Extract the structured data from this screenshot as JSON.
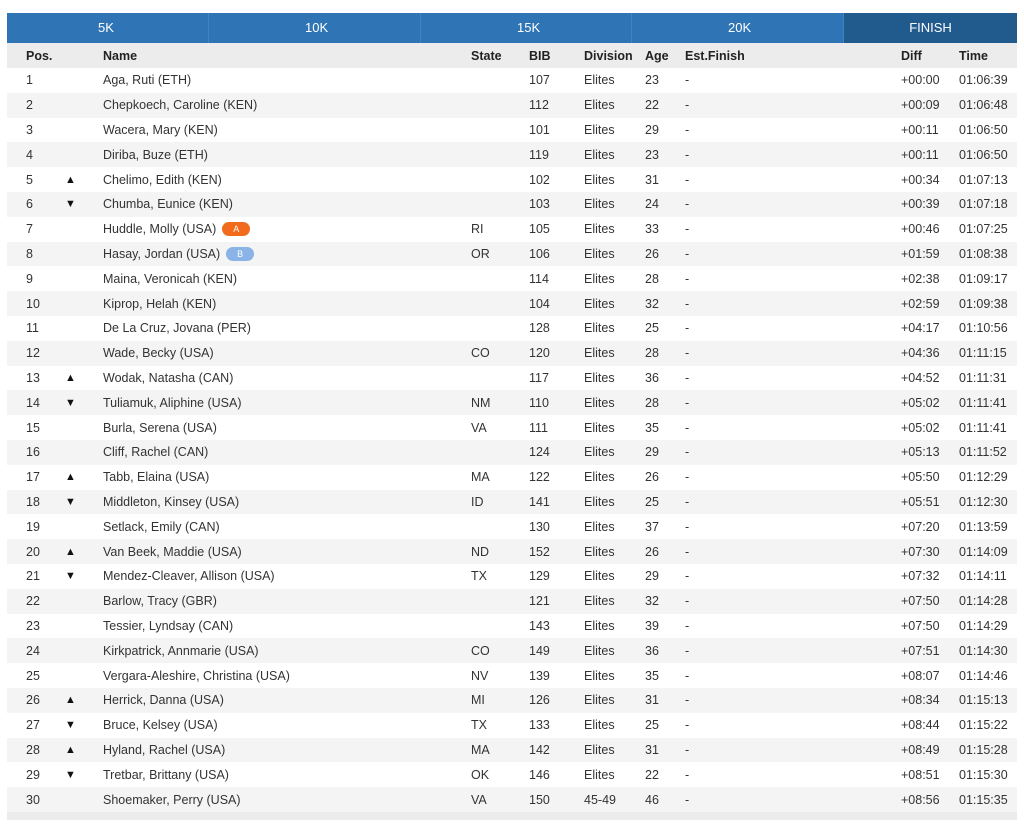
{
  "tabs": [
    {
      "label": "5K"
    },
    {
      "label": "10K"
    },
    {
      "label": "15K"
    },
    {
      "label": "20K"
    },
    {
      "label": "FINISH"
    }
  ],
  "columns": {
    "pos": "Pos.",
    "name": "Name",
    "state": "State",
    "bib": "BIB",
    "division": "Division",
    "age": "Age",
    "est": "Est.Finish",
    "diff": "Diff",
    "time": "Time"
  },
  "arrows": {
    "up": "▲",
    "down": "▼"
  },
  "colors": {
    "header_bar": "#2f74b5",
    "active_tab": "#215b8e",
    "badge_A": "#f26b1d",
    "badge_B": "#8ab4e8"
  },
  "rows": [
    {
      "pos": "1",
      "arrow": "",
      "name": "Aga, Ruti (ETH)",
      "badge": "",
      "state": "",
      "bib": "107",
      "division": "Elites",
      "age": "23",
      "est": "-",
      "diff": "+00:00",
      "time": "01:06:39"
    },
    {
      "pos": "2",
      "arrow": "",
      "name": "Chepkoech, Caroline (KEN)",
      "badge": "",
      "state": "",
      "bib": "112",
      "division": "Elites",
      "age": "22",
      "est": "-",
      "diff": "+00:09",
      "time": "01:06:48"
    },
    {
      "pos": "3",
      "arrow": "",
      "name": "Wacera, Mary (KEN)",
      "badge": "",
      "state": "",
      "bib": "101",
      "division": "Elites",
      "age": "29",
      "est": "-",
      "diff": "+00:11",
      "time": "01:06:50"
    },
    {
      "pos": "4",
      "arrow": "",
      "name": "Diriba, Buze (ETH)",
      "badge": "",
      "state": "",
      "bib": "119",
      "division": "Elites",
      "age": "23",
      "est": "-",
      "diff": "+00:11",
      "time": "01:06:50"
    },
    {
      "pos": "5",
      "arrow": "up",
      "name": "Chelimo, Edith (KEN)",
      "badge": "",
      "state": "",
      "bib": "102",
      "division": "Elites",
      "age": "31",
      "est": "-",
      "diff": "+00:34",
      "time": "01:07:13"
    },
    {
      "pos": "6",
      "arrow": "down",
      "name": "Chumba, Eunice (KEN)",
      "badge": "",
      "state": "",
      "bib": "103",
      "division": "Elites",
      "age": "24",
      "est": "-",
      "diff": "+00:39",
      "time": "01:07:18"
    },
    {
      "pos": "7",
      "arrow": "",
      "name": "Huddle, Molly (USA)",
      "badge": "A",
      "state": "RI",
      "bib": "105",
      "division": "Elites",
      "age": "33",
      "est": "-",
      "diff": "+00:46",
      "time": "01:07:25"
    },
    {
      "pos": "8",
      "arrow": "",
      "name": "Hasay, Jordan (USA)",
      "badge": "B",
      "state": "OR",
      "bib": "106",
      "division": "Elites",
      "age": "26",
      "est": "-",
      "diff": "+01:59",
      "time": "01:08:38"
    },
    {
      "pos": "9",
      "arrow": "",
      "name": "Maina, Veronicah (KEN)",
      "badge": "",
      "state": "",
      "bib": "114",
      "division": "Elites",
      "age": "28",
      "est": "-",
      "diff": "+02:38",
      "time": "01:09:17"
    },
    {
      "pos": "10",
      "arrow": "",
      "name": "Kiprop, Helah (KEN)",
      "badge": "",
      "state": "",
      "bib": "104",
      "division": "Elites",
      "age": "32",
      "est": "-",
      "diff": "+02:59",
      "time": "01:09:38"
    },
    {
      "pos": "11",
      "arrow": "",
      "name": "De La Cruz, Jovana (PER)",
      "badge": "",
      "state": "",
      "bib": "128",
      "division": "Elites",
      "age": "25",
      "est": "-",
      "diff": "+04:17",
      "time": "01:10:56"
    },
    {
      "pos": "12",
      "arrow": "",
      "name": "Wade, Becky (USA)",
      "badge": "",
      "state": "CO",
      "bib": "120",
      "division": "Elites",
      "age": "28",
      "est": "-",
      "diff": "+04:36",
      "time": "01:11:15"
    },
    {
      "pos": "13",
      "arrow": "up",
      "name": "Wodak, Natasha (CAN)",
      "badge": "",
      "state": "",
      "bib": "117",
      "division": "Elites",
      "age": "36",
      "est": "-",
      "diff": "+04:52",
      "time": "01:11:31"
    },
    {
      "pos": "14",
      "arrow": "down",
      "name": "Tuliamuk, Aliphine (USA)",
      "badge": "",
      "state": "NM",
      "bib": "110",
      "division": "Elites",
      "age": "28",
      "est": "-",
      "diff": "+05:02",
      "time": "01:11:41"
    },
    {
      "pos": "15",
      "arrow": "",
      "name": "Burla, Serena (USA)",
      "badge": "",
      "state": "VA",
      "bib": "111",
      "division": "Elites",
      "age": "35",
      "est": "-",
      "diff": "+05:02",
      "time": "01:11:41"
    },
    {
      "pos": "16",
      "arrow": "",
      "name": "Cliff, Rachel (CAN)",
      "badge": "",
      "state": "",
      "bib": "124",
      "division": "Elites",
      "age": "29",
      "est": "-",
      "diff": "+05:13",
      "time": "01:11:52"
    },
    {
      "pos": "17",
      "arrow": "up",
      "name": "Tabb, Elaina (USA)",
      "badge": "",
      "state": "MA",
      "bib": "122",
      "division": "Elites",
      "age": "26",
      "est": "-",
      "diff": "+05:50",
      "time": "01:12:29"
    },
    {
      "pos": "18",
      "arrow": "down",
      "name": "Middleton, Kinsey (USA)",
      "badge": "",
      "state": "ID",
      "bib": "141",
      "division": "Elites",
      "age": "25",
      "est": "-",
      "diff": "+05:51",
      "time": "01:12:30"
    },
    {
      "pos": "19",
      "arrow": "",
      "name": "Setlack, Emily (CAN)",
      "badge": "",
      "state": "",
      "bib": "130",
      "division": "Elites",
      "age": "37",
      "est": "-",
      "diff": "+07:20",
      "time": "01:13:59"
    },
    {
      "pos": "20",
      "arrow": "up",
      "name": "Van Beek, Maddie (USA)",
      "badge": "",
      "state": "ND",
      "bib": "152",
      "division": "Elites",
      "age": "26",
      "est": "-",
      "diff": "+07:30",
      "time": "01:14:09"
    },
    {
      "pos": "21",
      "arrow": "down",
      "name": "Mendez-Cleaver, Allison (USA)",
      "badge": "",
      "state": "TX",
      "bib": "129",
      "division": "Elites",
      "age": "29",
      "est": "-",
      "diff": "+07:32",
      "time": "01:14:11"
    },
    {
      "pos": "22",
      "arrow": "",
      "name": "Barlow, Tracy (GBR)",
      "badge": "",
      "state": "",
      "bib": "121",
      "division": "Elites",
      "age": "32",
      "est": "-",
      "diff": "+07:50",
      "time": "01:14:28"
    },
    {
      "pos": "23",
      "arrow": "",
      "name": "Tessier, Lyndsay (CAN)",
      "badge": "",
      "state": "",
      "bib": "143",
      "division": "Elites",
      "age": "39",
      "est": "-",
      "diff": "+07:50",
      "time": "01:14:29"
    },
    {
      "pos": "24",
      "arrow": "",
      "name": "Kirkpatrick, Annmarie (USA)",
      "badge": "",
      "state": "CO",
      "bib": "149",
      "division": "Elites",
      "age": "36",
      "est": "-",
      "diff": "+07:51",
      "time": "01:14:30"
    },
    {
      "pos": "25",
      "arrow": "",
      "name": "Vergara-Aleshire, Christina (USA)",
      "badge": "",
      "state": "NV",
      "bib": "139",
      "division": "Elites",
      "age": "35",
      "est": "-",
      "diff": "+08:07",
      "time": "01:14:46"
    },
    {
      "pos": "26",
      "arrow": "up",
      "name": "Herrick, Danna (USA)",
      "badge": "",
      "state": "MI",
      "bib": "126",
      "division": "Elites",
      "age": "31",
      "est": "-",
      "diff": "+08:34",
      "time": "01:15:13"
    },
    {
      "pos": "27",
      "arrow": "down",
      "name": "Bruce, Kelsey (USA)",
      "badge": "",
      "state": "TX",
      "bib": "133",
      "division": "Elites",
      "age": "25",
      "est": "-",
      "diff": "+08:44",
      "time": "01:15:22"
    },
    {
      "pos": "28",
      "arrow": "up",
      "name": "Hyland, Rachel (USA)",
      "badge": "",
      "state": "MA",
      "bib": "142",
      "division": "Elites",
      "age": "31",
      "est": "-",
      "diff": "+08:49",
      "time": "01:15:28"
    },
    {
      "pos": "29",
      "arrow": "down",
      "name": "Tretbar, Brittany (USA)",
      "badge": "",
      "state": "OK",
      "bib": "146",
      "division": "Elites",
      "age": "22",
      "est": "-",
      "diff": "+08:51",
      "time": "01:15:30"
    },
    {
      "pos": "30",
      "arrow": "",
      "name": "Shoemaker, Perry (USA)",
      "badge": "",
      "state": "VA",
      "bib": "150",
      "division": "45-49",
      "age": "46",
      "est": "-",
      "diff": "+08:56",
      "time": "01:15:35"
    }
  ]
}
